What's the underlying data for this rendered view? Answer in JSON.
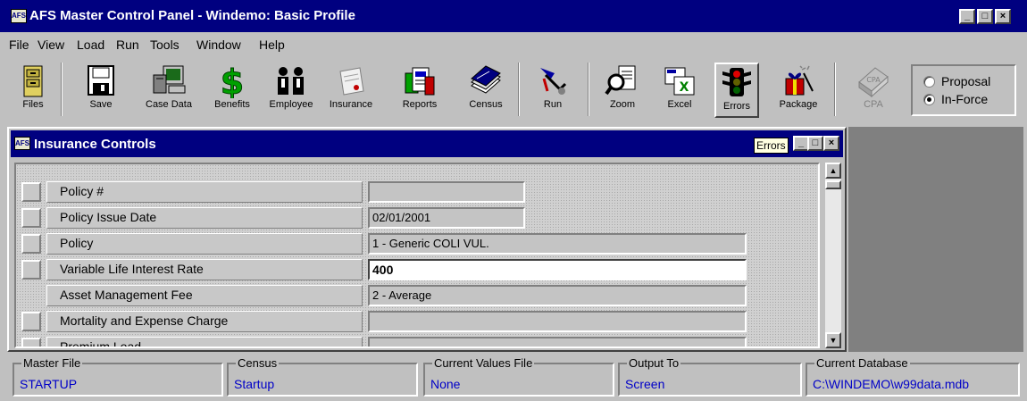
{
  "window": {
    "app_icon": "AFS",
    "title": "AFS Master Control Panel - Windemo: Basic Profile"
  },
  "menu": [
    "File",
    "View",
    "Load",
    "Run",
    "Tools",
    "Window",
    "Help"
  ],
  "toolbar": {
    "buttons": [
      {
        "label": "Files",
        "icon": "files-cabinet-icon"
      },
      {
        "label": "Save",
        "icon": "floppy-disk-icon"
      },
      {
        "label": "Case Data",
        "icon": "case-data-computer-icon"
      },
      {
        "label": "Benefits",
        "icon": "dollar-sign-icon"
      },
      {
        "label": "Employee",
        "icon": "people-icon"
      },
      {
        "label": "Insurance",
        "icon": "insurance-document-icon"
      },
      {
        "label": "Reports",
        "icon": "reports-stack-icon"
      },
      {
        "label": "Census",
        "icon": "census-cards-icon"
      },
      {
        "label": "Run",
        "icon": "run-icon"
      },
      {
        "label": "Zoom",
        "icon": "zoom-magnifier-icon"
      },
      {
        "label": "Excel",
        "icon": "excel-icon"
      },
      {
        "label": "Errors",
        "icon": "traffic-light-icon"
      },
      {
        "label": "Package",
        "icon": "package-gift-icon"
      },
      {
        "label": "CPA",
        "icon": "cpa-book-icon"
      }
    ],
    "radio": [
      {
        "label": "Proposal",
        "checked": false
      },
      {
        "label": "In-Force",
        "checked": true
      }
    ]
  },
  "child_window": {
    "app_icon": "AFS",
    "title": "Insurance Controls",
    "tooltip": "Errors",
    "rows": [
      {
        "label": "Policy #",
        "value": "",
        "has_selector": true,
        "editable": false
      },
      {
        "label": "Policy Issue Date",
        "value": "02/01/2001",
        "has_selector": true,
        "editable": false
      },
      {
        "label": "Policy",
        "value": "1 - Generic COLI VUL.",
        "has_selector": true,
        "editable": false
      },
      {
        "label": "Variable Life Interest Rate",
        "value": "400",
        "has_selector": true,
        "editable": true
      },
      {
        "label": "Asset Management Fee",
        "value": "2 - Average",
        "has_selector": false,
        "editable": false
      },
      {
        "label": "Mortality and Expense Charge",
        "value": "",
        "has_selector": true,
        "editable": false
      },
      {
        "label": "Premium Load",
        "value": "",
        "has_selector": true,
        "editable": false
      }
    ]
  },
  "status": [
    {
      "caption": "Master File",
      "value": "STARTUP"
    },
    {
      "caption": "Census",
      "value": "Startup"
    },
    {
      "caption": "Current Values File",
      "value": "None"
    },
    {
      "caption": "Output To",
      "value": "Screen"
    },
    {
      "caption": "Current Database",
      "value": "C:\\WINDEMO\\w99data.mdb"
    }
  ]
}
